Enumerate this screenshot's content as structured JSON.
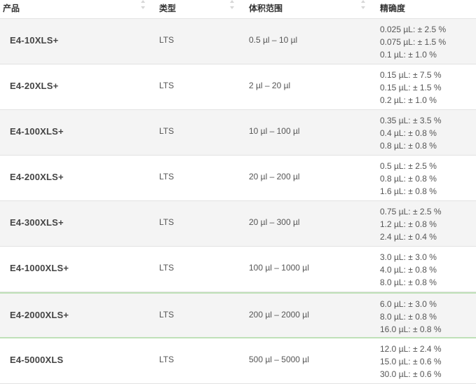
{
  "headers": [
    "产品",
    "类型",
    "体积范围",
    "精确度"
  ],
  "rows": [
    {
      "product": "E4-10XLS+",
      "type": "LTS",
      "volume": "0.5 µl – 10 µl",
      "accuracy": [
        "0.025 µL: ± 2.5 %",
        "0.075 µL: ± 1.5 %",
        "0.1 µL: ± 1.0 %"
      ]
    },
    {
      "product": "E4-20XLS+",
      "type": "LTS",
      "volume": "2 µl – 20 µl",
      "accuracy": [
        "0.15 µL: ± 7.5 %",
        "0.15 µL: ± 1.5 %",
        "0.2 µL: ± 1.0 %"
      ]
    },
    {
      "product": "E4-100XLS+",
      "type": "LTS",
      "volume": "10 µl – 100 µl",
      "accuracy": [
        "0.35 µL: ± 3.5 %",
        "0.4 µL: ± 0.8 %",
        "0.8 µL: ± 0.8 %"
      ]
    },
    {
      "product": "E4-200XLS+",
      "type": "LTS",
      "volume": "20 µl – 200 µl",
      "accuracy": [
        "0.5 µL: ± 2.5 %",
        "0.8 µL: ± 0.8 %",
        "1.6 µL: ± 0.8 %"
      ]
    },
    {
      "product": "E4-300XLS+",
      "type": "LTS",
      "volume": "20 µl – 300 µl",
      "accuracy": [
        "0.75 µL: ± 2.5 %",
        "1.2 µL: ± 0.8 %",
        "2.4 µL: ± 0.4 %"
      ]
    },
    {
      "product": "E4-1000XLS+",
      "type": "LTS",
      "volume": "100 µl – 1000 µl",
      "accuracy": [
        "3.0 µL: ± 3.0 %",
        "4.0 µL: ± 0.8 %",
        "8.0 µL: ± 0.8 %"
      ]
    },
    {
      "product": "E4-2000XLS+",
      "type": "LTS",
      "volume": "200 µl – 2000 µl",
      "accuracy": [
        "6.0 µL: ± 3.0 %",
        "8.0 µL: ± 0.8 %",
        "16.0 µL: ± 0.8 %"
      ]
    },
    {
      "product": "E4-5000XLS",
      "type": "LTS",
      "volume": "500 µl – 5000 µl",
      "accuracy": [
        "12.0 µL: ± 2.4 %",
        "15.0 µL: ± 0.6 %",
        "30.0 µL: ± 0.6 %"
      ]
    }
  ]
}
